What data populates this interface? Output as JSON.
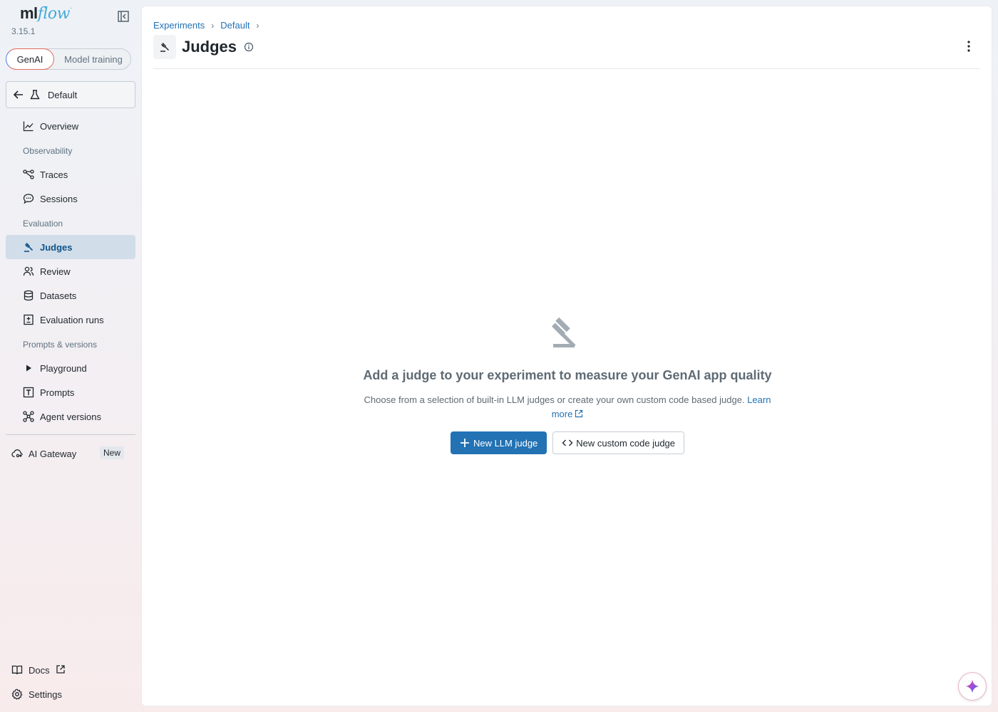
{
  "app": {
    "logo_ml": "ml",
    "logo_flow": "flow",
    "version": "3.15.1"
  },
  "workspace_toggle": {
    "options": [
      "GenAI",
      "Model training"
    ],
    "selected": "GenAI"
  },
  "experiment_selector": {
    "label": "Default"
  },
  "sidebar": {
    "overview": "Overview",
    "sections": {
      "observability": "Observability",
      "evaluation": "Evaluation",
      "prompts_versions": "Prompts & versions"
    },
    "items": {
      "traces": "Traces",
      "sessions": "Sessions",
      "judges": "Judges",
      "review": "Review",
      "datasets": "Datasets",
      "evaluation_runs": "Evaluation runs",
      "playground": "Playground",
      "prompts": "Prompts",
      "agent_versions": "Agent versions"
    },
    "active": "judges",
    "gateway": {
      "label": "AI Gateway",
      "badge": "New"
    },
    "docs": "Docs",
    "settings": "Settings"
  },
  "breadcrumb": [
    "Experiments",
    "Default"
  ],
  "page": {
    "title": "Judges"
  },
  "empty_state": {
    "heading": "Add a judge to your experiment to measure your GenAI app quality",
    "description": "Choose from a selection of built-in LLM judges or create your own custom code based judge.",
    "learn_more": "Learn more",
    "primary_button": "New LLM judge",
    "secondary_button": "New custom code judge"
  },
  "colors": {
    "accent": "#2272b4",
    "active_nav_bg": "#d1dde9",
    "active_nav_text": "#0e538b"
  },
  "icons": {
    "collapse": "sidebar-collapse-icon",
    "back": "arrow-left-icon",
    "experiment": "beaker-icon",
    "judges": "gavel-icon",
    "info": "info-icon",
    "more": "kebab-menu-icon",
    "assistant": "sparkle-icon"
  }
}
